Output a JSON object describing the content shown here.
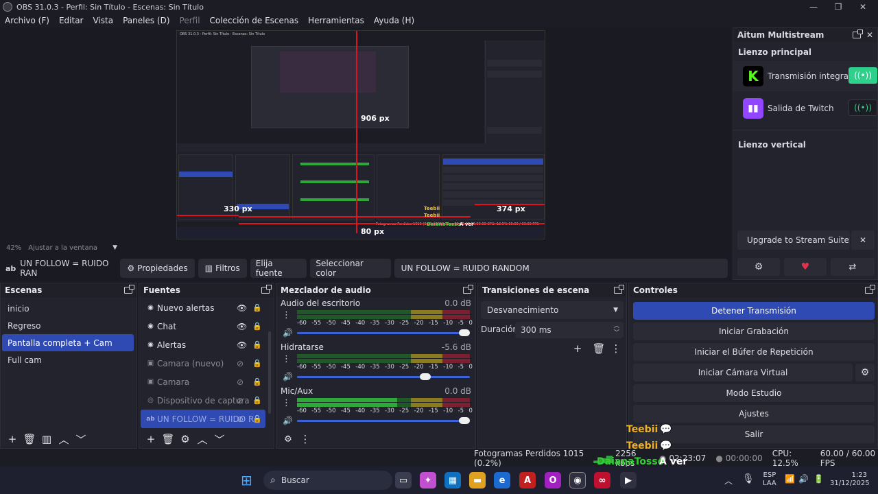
{
  "window": {
    "title": "OBS 31.0.3 - Perfil: Sin Título - Escenas: Sin Título",
    "controls": [
      "—",
      "❐",
      "✕"
    ]
  },
  "menu": [
    {
      "label": "Archivo (F)",
      "disabled": false
    },
    {
      "label": "Editar",
      "disabled": false
    },
    {
      "label": "Vista",
      "disabled": false
    },
    {
      "label": "Paneles (D)",
      "disabled": false
    },
    {
      "label": "Perfil",
      "disabled": true
    },
    {
      "label": "Colección de Escenas",
      "disabled": false
    },
    {
      "label": "Herramientas",
      "disabled": false
    },
    {
      "label": "Ayuda (H)",
      "disabled": false
    }
  ],
  "preview": {
    "measures": {
      "top": "906 px",
      "left": "330 px",
      "right": "374 px",
      "bottom": "80 px",
      "top_small": "374 px"
    },
    "mini_chat": [
      {
        "name": "Teebii",
        "msg": ""
      },
      {
        "name": "Teebii",
        "msg": ""
      },
      {
        "name": "DaianaTosso",
        "msg": "A ver"
      }
    ],
    "mini_title": "OBS 31.0.3 - Perfil: Sin Título - Escenas: Sin Título",
    "mini_fps": "Fotogramas Perdidos 1015 (0.2%)  2256 kbps  02:23:07  00:00:00  CPU: 12.5%  60.00 / 60.00 FPS"
  },
  "zoom": {
    "percent": "42%",
    "label": "Ajustar a la ventana"
  },
  "source_toolbar": {
    "current_source": "UN FOLLOW = RUIDO RAN",
    "properties": "Propiedades",
    "filters": "Filtros",
    "choose_source": "Elija fuente",
    "choose_color": "Seleccionar color",
    "text_value": "UN FOLLOW = RUIDO RANDOM"
  },
  "scenes": {
    "title": "Escenas",
    "items": [
      {
        "label": "inicio",
        "selected": false
      },
      {
        "label": "Regreso",
        "selected": false
      },
      {
        "label": "Pantalla completa + Cam",
        "selected": true
      },
      {
        "label": "Full cam",
        "selected": false
      }
    ]
  },
  "sources": {
    "title": "Fuentes",
    "items": [
      {
        "label": "Nuevo alertas",
        "icon": "browser-icon",
        "visible": true,
        "dim": false,
        "selected": false
      },
      {
        "label": "Chat",
        "icon": "browser-icon",
        "visible": true,
        "dim": false,
        "selected": false
      },
      {
        "label": "Alertas",
        "icon": "browser-icon",
        "visible": true,
        "dim": false,
        "selected": false
      },
      {
        "label": "Camara (nuevo)",
        "icon": "image-icon",
        "visible": false,
        "dim": true,
        "selected": false
      },
      {
        "label": "Camara",
        "icon": "image-icon",
        "visible": false,
        "dim": true,
        "selected": false
      },
      {
        "label": "Dispositivo de captura",
        "icon": "camera-icon",
        "visible": false,
        "dim": true,
        "selected": false
      },
      {
        "label": "UN FOLLOW = RUIDO R",
        "icon": "text-icon",
        "visible": false,
        "dim": false,
        "selected": true
      }
    ]
  },
  "mixer": {
    "title": "Mezclador de audio",
    "ticks": [
      "-60",
      "-55",
      "-50",
      "-45",
      "-40",
      "-35",
      "-30",
      "-25",
      "-20",
      "-15",
      "-10",
      "-5",
      "0"
    ],
    "channels": [
      {
        "name": "Audio del escritorio",
        "db": "0.0 dB",
        "level": 0.0,
        "volume": 1.0
      },
      {
        "name": "Hidratarse",
        "db": "-5.6 dB",
        "level": 0.0,
        "volume": 0.76
      },
      {
        "name": "Mic/Aux",
        "db": "0.0 dB",
        "level": 0.58,
        "volume": 1.0
      }
    ]
  },
  "transitions": {
    "title": "Transiciones de escena",
    "selected": "Desvanecimiento",
    "duration_label": "Duración",
    "duration_value": "300 ms"
  },
  "controls": {
    "title": "Controles",
    "buttons": [
      {
        "label": "Detener Transmisión",
        "primary": true
      },
      {
        "label": "Iniciar Grabación",
        "primary": false
      },
      {
        "label": "Iniciar el Búfer de Repetición",
        "primary": false
      },
      {
        "label": "Iniciar Cámara Virtual",
        "primary": false
      },
      {
        "label": "Modo Estudio",
        "primary": false
      },
      {
        "label": "Ajustes",
        "primary": false
      },
      {
        "label": "Salir",
        "primary": false
      }
    ]
  },
  "multistream": {
    "title": "Aitum Multistream",
    "main_canvas": "Lienzo principal",
    "outputs": [
      {
        "label": "Transmisión integrada",
        "platform": "kick",
        "active": true
      },
      {
        "label": "Salida de Twitch",
        "platform": "twitch",
        "active": false
      }
    ],
    "vertical_canvas": "Lienzo vertical",
    "upgrade": "Upgrade to Stream Suite",
    "close": "✕"
  },
  "chat_overlay": [
    {
      "name": "Teebii",
      "msg": ""
    },
    {
      "name": "Teebii",
      "msg": ""
    },
    {
      "name": "DaianaTosso",
      "msg": "A ver"
    }
  ],
  "status": {
    "dropped": "Fotogramas Perdidos 1015 (0.2%)",
    "kbps": "2256 kbps",
    "stream_time": "02:23:07",
    "rec_time": "00:00:00",
    "cpu": "CPU: 12.5%",
    "fps": "60.00 / 60.00 FPS"
  },
  "taskbar": {
    "search": "Buscar",
    "lang": "ESP",
    "region": "LAA",
    "time": "1:23",
    "date": "31/12/2025"
  }
}
